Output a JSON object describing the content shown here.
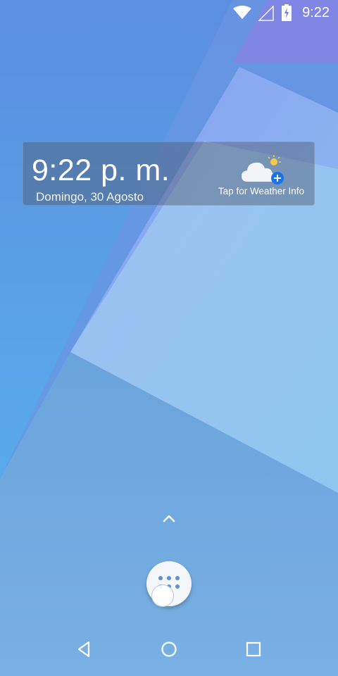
{
  "status_bar": {
    "time": "9:22",
    "icons": [
      "wifi-icon",
      "cell-signal-icon",
      "battery-charging-icon"
    ]
  },
  "widget": {
    "clock": "9:22 p. m.",
    "date": "Domingo, 30 Agosto",
    "weather_label": "Tap for Weather Info",
    "weather_icon": "partly-cloudy-add-icon"
  },
  "dock": {
    "up_arrow_icon": "chevron-up-icon",
    "app_drawer_icon": "app-drawer-icon"
  },
  "nav_bar": {
    "buttons": [
      "back-icon",
      "home-icon",
      "recents-icon"
    ]
  },
  "colors": {
    "wallpaper_light": "#9fd0f2",
    "wallpaper_mid": "#5aa6e6",
    "wallpaper_purple": "#7a86e6",
    "accent_blue": "#1a73e8"
  }
}
